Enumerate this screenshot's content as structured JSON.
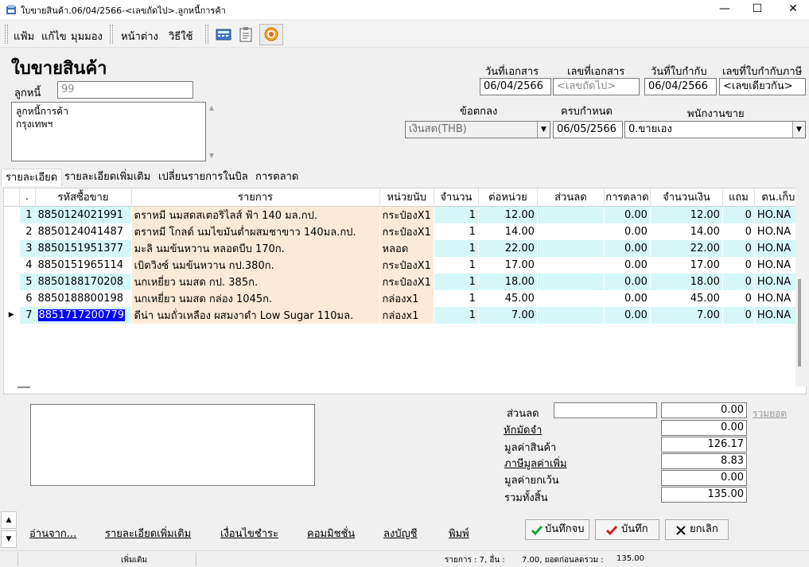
{
  "window": {
    "title": "ใบขายสินค้า.06/04/2566-<เลขถัดไป>.ลูกหนี้การค้า",
    "minimize": "—",
    "maximize": "☐",
    "close": "✕"
  },
  "menu": [
    "แฟ้ม",
    "แก้ไข",
    "มุมมอง",
    "หน้าต่าง",
    "วิธีใช้"
  ],
  "form": {
    "title": "ใบขายสินค้า",
    "debtor_label": "ลูกหนี้",
    "debtor_value": "99",
    "address_lines": [
      "ลูกหนี้การค้า",
      "กรุงเทพฯ"
    ],
    "doc_date_label": "วันที่เอกสาร",
    "doc_date": "06/04/2566",
    "doc_no_label": "เลขที่เอกสาร",
    "doc_no": "<เลขถัดไป>",
    "tax_date_label": "วันที่ใบกำกับ",
    "tax_date": "06/04/2566",
    "tax_no_label": "เลขที่ใบกำกับภาษี",
    "tax_no": "<เลขเดียวกัน>",
    "terms_label": "ข้อตกลง",
    "terms_value": "เงินสด(THB)",
    "due_label": "ครบกำหนด",
    "due_value": "06/05/2566",
    "salesman_label": "พนักงานขาย",
    "salesman_value": "0.ขายเอง"
  },
  "tabs": [
    "รายละเอียด",
    "รายละเอียดเพิ่มเติม",
    "เปลี่ยนรายการในบิล",
    "การตลาด"
  ],
  "grid": {
    "headers": [
      ".",
      "รหัสซื้อขาย",
      "รายการ",
      "หน่วยนับ",
      "จำนวน",
      "ต่อหน่วย",
      "ส่วนลด",
      "การตลาด",
      "จำนวนเงิน",
      "แถม",
      "ตน.เก็บ"
    ],
    "rows": [
      {
        "no": "1",
        "code": "8850124021991",
        "item": "ตราหมี นมสดสเตอริไลส์ ฟ้า 140 มล.กป.",
        "unit": "กระป๋องX1",
        "qty": "1",
        "price": "12.00",
        "discount": "",
        "marketing": "0.00",
        "amount": "12.00",
        "free": "0",
        "store": "HO.NA"
      },
      {
        "no": "2",
        "code": "8850124041487",
        "item": "ตราหมี โกลด์ นมไขมันต่ำผสมชาขาว 140มล.กป.",
        "unit": "กระป๋องX1",
        "qty": "1",
        "price": "14.00",
        "discount": "",
        "marketing": "0.00",
        "amount": "14.00",
        "free": "0",
        "store": "HO.NA"
      },
      {
        "no": "3",
        "code": "8850151951377",
        "item": "มะลิ นมข้นหวาน หลอดบีบ 170ก.",
        "unit": "หลอด",
        "qty": "1",
        "price": "22.00",
        "discount": "",
        "marketing": "0.00",
        "amount": "22.00",
        "free": "0",
        "store": "HO.NA"
      },
      {
        "no": "4",
        "code": "8850151965114",
        "item": "เบิดวิงซ์ นมข้นหวาน กป.380ก.",
        "unit": "กระป๋องX1",
        "qty": "1",
        "price": "17.00",
        "discount": "",
        "marketing": "0.00",
        "amount": "17.00",
        "free": "0",
        "store": "HO.NA"
      },
      {
        "no": "5",
        "code": "8850188170208",
        "item": "นกเหยี่ยว นมสด กป. 385ก.",
        "unit": "กระป๋องX1",
        "qty": "1",
        "price": "18.00",
        "discount": "",
        "marketing": "0.00",
        "amount": "18.00",
        "free": "0",
        "store": "HO.NA"
      },
      {
        "no": "6",
        "code": "8850188800198",
        "item": "นกเหยี่ยว นมสด กล่อง 1045ก.",
        "unit": "กล่องx1",
        "qty": "1",
        "price": "45.00",
        "discount": "",
        "marketing": "0.00",
        "amount": "45.00",
        "free": "0",
        "store": "HO.NA"
      },
      {
        "no": "7",
        "code": "8851717200779",
        "item": "ดีน่า นมถั่วเหลือง ผสมงาดำ Low Sugar 110มล.",
        "unit": "กล่องx1",
        "qty": "1",
        "price": "7.00",
        "discount": "",
        "marketing": "0.00",
        "amount": "7.00",
        "free": "0",
        "store": "HO.NA"
      }
    ]
  },
  "summary": {
    "discount_label": "ส่วนลด",
    "discount_value": "0.00",
    "total_link": "รวมยอด",
    "deposit_label": "หักมัดจำ",
    "deposit_value": "0.00",
    "goods_label": "มูลค่าสินค้า",
    "goods_value": "126.17",
    "vat_label": "ภาษีมูลค่าเพิ่ม",
    "vat_value": "8.83",
    "exempt_label": "มูลค่ายกเว้น",
    "exempt_value": "0.00",
    "grand_label": "รวมทั้งสิ้น",
    "grand_value": "135.00"
  },
  "footer_links": [
    "อ่านจาก...",
    "รายละเอียดเพิ่มเติม",
    "เงื่อนไขชำระ",
    "คอมมิชชั่น",
    "ลงบัญชี",
    "พิมพ์"
  ],
  "buttons": {
    "save_close": "บันทึกจบ",
    "save": "บันทึก",
    "cancel": "ยกเลิก"
  },
  "status": {
    "mode": "เพิ่มเติม",
    "items": "รายการ : 7, อื่น :",
    "items_value": "7.00, ยอดก่อนลดรวม :",
    "total_before": "135.00"
  },
  "colors": {
    "row_cyan": "#d5f7f7",
    "row_peach": "#fcead8",
    "selection": "#0000ff",
    "save_check": "#21a336",
    "cancel_x": "#111111",
    "save_red": "#d42020"
  }
}
